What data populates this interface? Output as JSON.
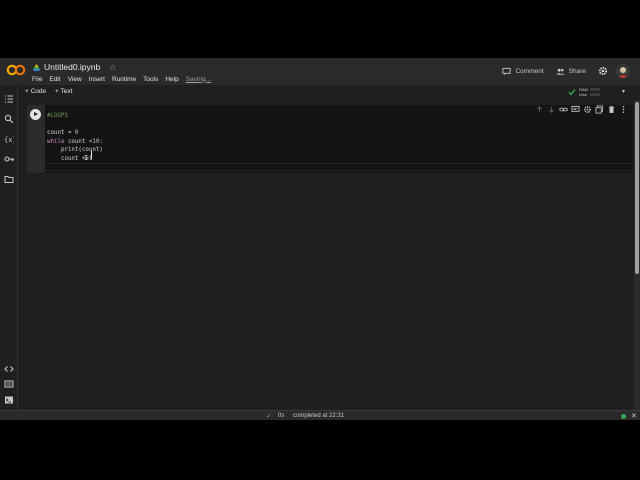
{
  "header": {
    "title": "Untitled0.ipynb",
    "saving": "Saving...",
    "comment": "Comment",
    "share": "Share"
  },
  "menu": [
    "File",
    "Edit",
    "View",
    "Insert",
    "Runtime",
    "Tools",
    "Help"
  ],
  "toolbar": {
    "add_code": "+ Code",
    "add_text": "+ Text",
    "ram": "RAM",
    "disk": "Disk"
  },
  "cell": {
    "lines": [
      "#LOOPS",
      "",
      "count = 0",
      "while count <10:",
      "    print(count)",
      "    count +=1"
    ]
  },
  "status": {
    "time": "0s",
    "message": "completed at 22:31"
  },
  "icons": {
    "logo": "colab-logo",
    "sidebar": [
      "toc-icon",
      "search-icon",
      "variables-icon",
      "key-icon",
      "folder-icon",
      "code-snippets-icon",
      "command-palette-icon",
      "terminal-icon"
    ],
    "cell_tools": [
      "move-up-icon",
      "move-down-icon",
      "link-icon",
      "comment-icon",
      "settings-icon",
      "mirror-icon",
      "delete-icon",
      "more-icon"
    ]
  },
  "colors": {
    "accent": "#f9ab00",
    "background": "#1f1f1f",
    "editor": "#141414",
    "ok": "#34a853"
  }
}
